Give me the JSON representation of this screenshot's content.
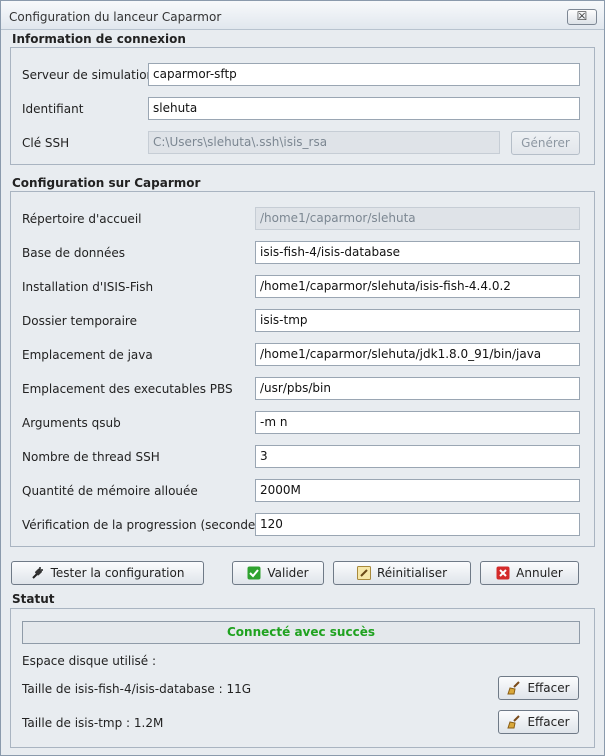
{
  "window": {
    "title": "Configuration du lanceur Caparmor",
    "close_label": "☒"
  },
  "connexion": {
    "title": "Information de connexion",
    "server": {
      "label": "Serveur de simulation",
      "value": "caparmor-sftp"
    },
    "login": {
      "label": "Identifiant",
      "value": "slehuta"
    },
    "ssh": {
      "label": "Clé SSH",
      "value": "C:\\Users\\slehuta\\.ssh\\isis_rsa",
      "button": "Générer"
    }
  },
  "caparmor": {
    "title": "Configuration sur Caparmor",
    "fields": [
      {
        "label": "Répertoire d'accueil",
        "value": "/home1/caparmor/slehuta",
        "disabled": true
      },
      {
        "label": "Base de données",
        "value": "isis-fish-4/isis-database"
      },
      {
        "label": "Installation d'ISIS-Fish",
        "value": "/home1/caparmor/slehuta/isis-fish-4.4.0.2"
      },
      {
        "label": "Dossier temporaire",
        "value": "isis-tmp"
      },
      {
        "label": "Emplacement de java",
        "value": "/home1/caparmor/slehuta/jdk1.8.0_91/bin/java"
      },
      {
        "label": "Emplacement des executables PBS",
        "value": "/usr/pbs/bin"
      },
      {
        "label": "Arguments qsub",
        "value": "-m n"
      },
      {
        "label": "Nombre de thread SSH",
        "value": "3"
      },
      {
        "label": "Quantité de mémoire allouée",
        "value": "2000M"
      },
      {
        "label": "Vérification de la progression (secondes)",
        "value": "120"
      }
    ]
  },
  "actions": {
    "test": "Tester la configuration",
    "validate": "Valider",
    "reset": "Réinitialiser",
    "cancel": "Annuler"
  },
  "status": {
    "title": "Statut",
    "message": "Connecté avec succès",
    "message_color": "#1fa21f",
    "disk_label": "Espace disque utilisé :",
    "database_size": "Taille de isis-fish-4/isis-database : 11G",
    "tmp_size": "Taille de isis-tmp : 1.2M",
    "clear_label": "Effacer"
  },
  "icons": {
    "test": "plug-icon",
    "validate": "check-icon",
    "reset": "pencil-icon",
    "cancel": "cross-icon",
    "clear": "broom-icon"
  }
}
